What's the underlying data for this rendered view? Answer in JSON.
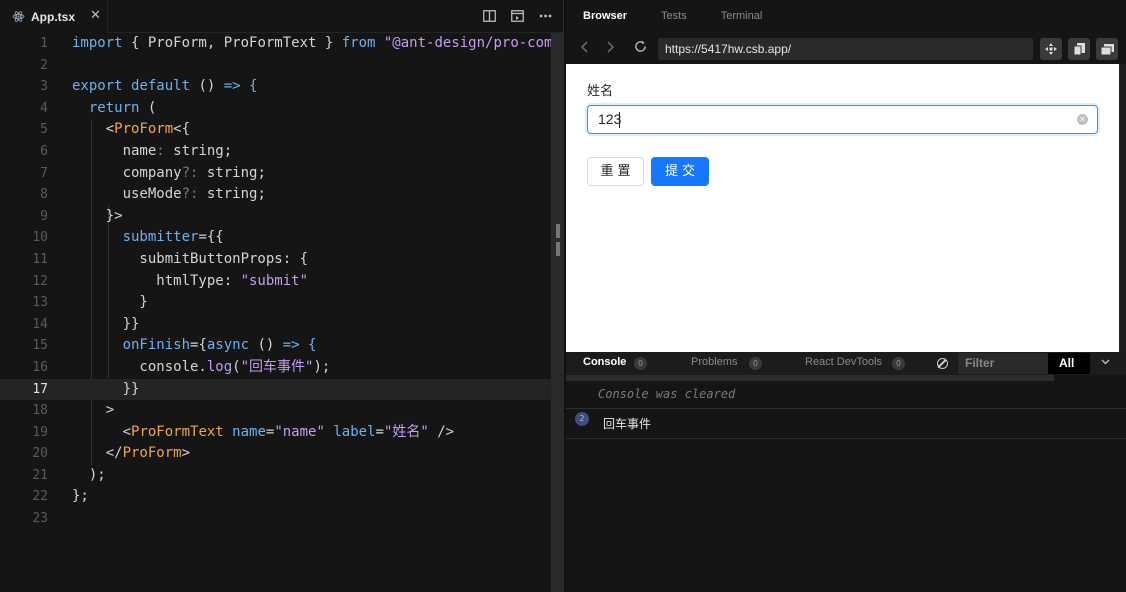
{
  "editor": {
    "tab": {
      "filename": "App.tsx",
      "close": "✕"
    },
    "actions": [
      "split-editor-icon",
      "preview-icon",
      "more-icon"
    ],
    "line_numbers": [
      "1",
      "2",
      "3",
      "4",
      "5",
      "6",
      "7",
      "8",
      "9",
      "10",
      "11",
      "12",
      "13",
      "14",
      "15",
      "16",
      "17",
      "18",
      "19",
      "20",
      "21",
      "22",
      "23"
    ],
    "active_line": 17,
    "code": {
      "l1": {
        "a": "import",
        "b": " { ProForm, ProFormText } ",
        "c": "from",
        "d": " \"@ant-design/pro-com"
      },
      "l3": {
        "a": "export",
        "b": " ",
        "c": "default",
        "d": " () ",
        "e": "=>",
        "f": " {"
      },
      "l4": {
        "a": "  ",
        "b": "return",
        "c": " ("
      },
      "l5": {
        "a": "    <",
        "b": "ProForm",
        "c": "<{"
      },
      "l6": {
        "a": "      name",
        "b": ":",
        "c": " string;"
      },
      "l7": {
        "a": "      company",
        "b": "?:",
        "c": " string;"
      },
      "l8": {
        "a": "      useMode",
        "b": "?:",
        "c": " string;"
      },
      "l9": "    }>",
      "l10": {
        "a": "      ",
        "b": "submitter",
        "c": "={{"
      },
      "l11": {
        "a": "        submitButtonProps: {"
      },
      "l12": {
        "a": "          htmlType: ",
        "b": "\"submit\""
      },
      "l13": "        }",
      "l14": "      }}",
      "l15": {
        "a": "      ",
        "b": "onFinish",
        "c": "={",
        "d": "async",
        "e": " () ",
        "f": "=>",
        "g": " {"
      },
      "l16": {
        "a": "        console.",
        "b": "log",
        "c": "(",
        "d": "\"回车事件\"",
        "e": ");"
      },
      "l17": "      }}",
      "l18": "    >",
      "l19": {
        "a": "      <",
        "b": "ProFormText",
        "c": " ",
        "d": "name",
        "e": "=",
        "f": "\"name\"",
        "g": " ",
        "h": "label",
        "i": "=",
        "j": "\"姓名\"",
        "k": " />"
      },
      "l20": {
        "a": "    </",
        "b": "ProForm",
        "c": ">"
      },
      "l21": "  );",
      "l22": "};"
    }
  },
  "preview": {
    "tabs": [
      "Browser",
      "Tests",
      "Terminal"
    ],
    "active_tab": "Browser",
    "url": "https://5417hw.csb.app/",
    "form": {
      "label": "姓名",
      "value": "123",
      "reset": "重置",
      "submit": "提交"
    },
    "console": {
      "tabs": [
        {
          "label": "Console",
          "count": "0"
        },
        {
          "label": "Problems",
          "count": "0"
        },
        {
          "label": "React DevTools",
          "count": "0"
        }
      ],
      "filter_placeholder": "Filter",
      "level": "All",
      "cleared_message": "Console was cleared",
      "log": {
        "count": "2",
        "message": "回车事件"
      }
    }
  },
  "colors": {
    "keyword": "#6cb2f0",
    "component": "#f0a64a",
    "string": "#c59cf2",
    "primary_button": "#1677ff"
  }
}
